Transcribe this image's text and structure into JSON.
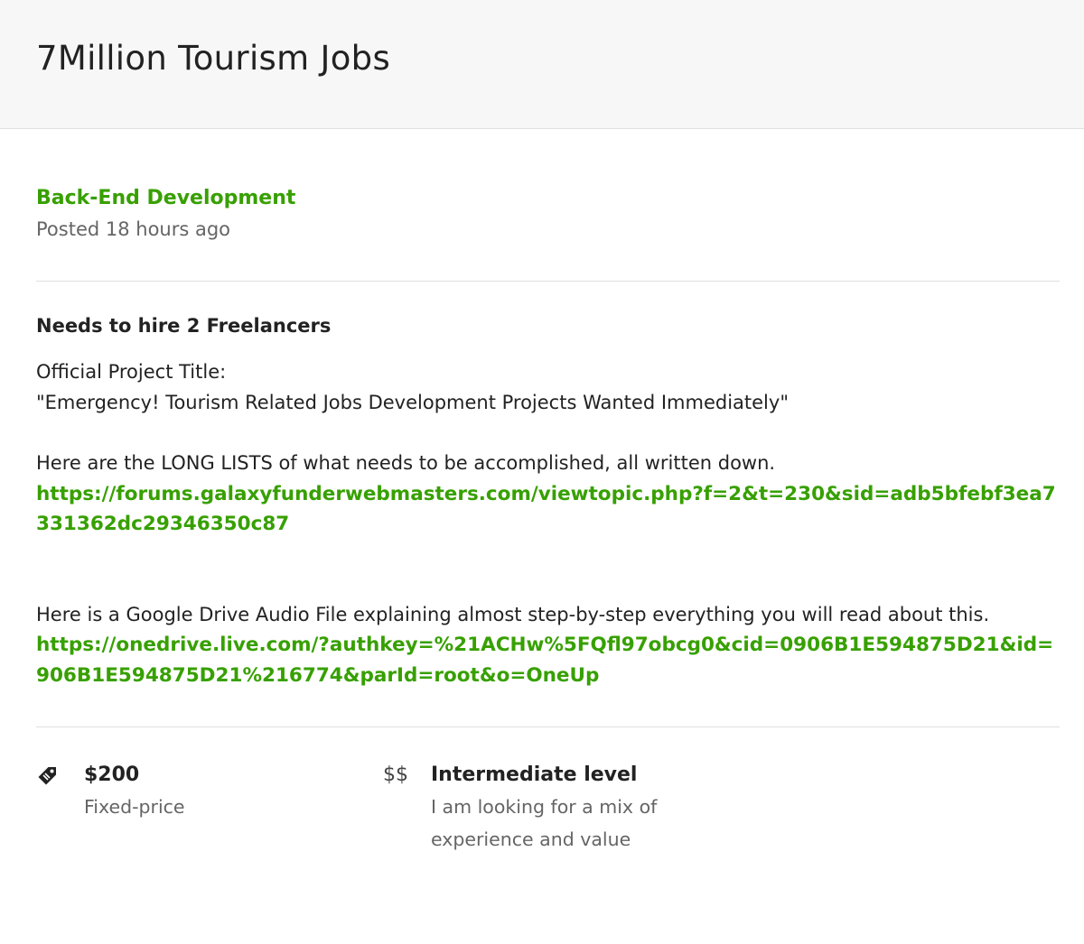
{
  "header": {
    "title": "7Million Tourism Jobs"
  },
  "job": {
    "category": "Back-End Development",
    "posted": "Posted 18 hours ago",
    "hire_text": "Needs to hire 2 Freelancers",
    "description": {
      "line1": "Official Project Title:",
      "line2": "\"Emergency! Tourism Related Jobs Development Projects Wanted Immediately\"",
      "line3": "Here are the LONG LISTS of what needs to be accomplished, all written down.",
      "link1": "https://forums.galaxyfunderwebmasters.com/viewtopic.php?f=2&t=230&sid=adb5bfebf3ea7331362dc29346350c87",
      "line4": "Here is a Google Drive Audio File explaining almost step-by-step everything you will read about this.",
      "link2": "https://onedrive.live.com/?authkey=%21ACHw%5FQfl97obcg0&cid=0906B1E594875D21&id=906B1E594875D21%216774&parId=root&o=OneUp"
    }
  },
  "meta": {
    "price": {
      "icon": "price-tag-icon",
      "value": "$200",
      "type": "Fixed-price"
    },
    "level": {
      "icon_text": "$$",
      "title": "Intermediate level",
      "description": "I am looking for a mix of experience and value"
    }
  }
}
